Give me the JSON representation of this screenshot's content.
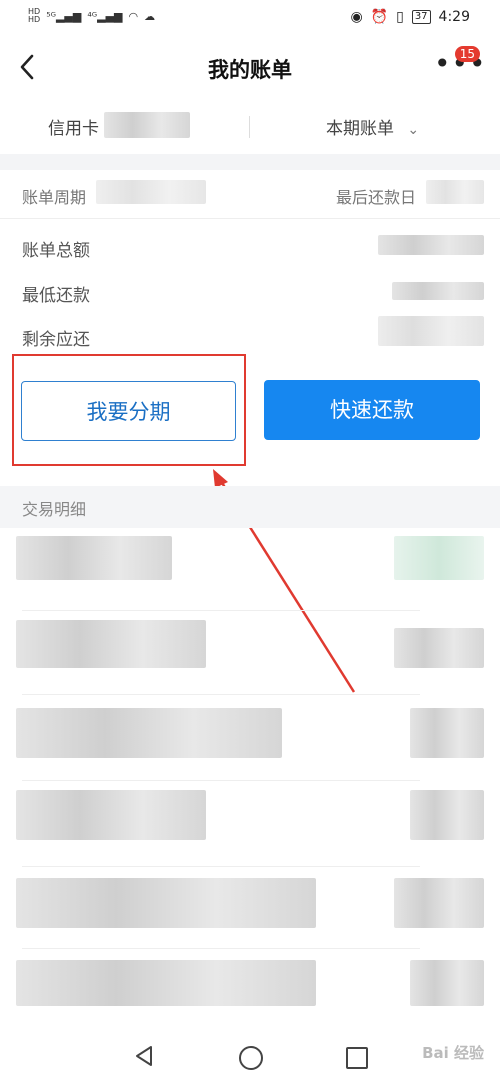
{
  "status_bar": {
    "signal_left": "HD 5G 4G",
    "time": "4:29",
    "battery": "37"
  },
  "header": {
    "title": "我的账单",
    "more_badge": "15"
  },
  "selector": {
    "card_label": "信用卡",
    "period_label": "本期账单"
  },
  "bill_info": {
    "period_label": "账单周期",
    "due_label": "最后还款日"
  },
  "amounts": [
    {
      "label": "账单总额"
    },
    {
      "label": "最低还款"
    },
    {
      "label": "剩余应还"
    }
  ],
  "actions": {
    "installment_label": "我要分期",
    "repay_label": "快速还款"
  },
  "transactions": {
    "title": "交易明细"
  },
  "watermark": "Bai 经验",
  "colors": {
    "primary": "#1687f0",
    "highlight": "#e03a30",
    "badge": "#e43a2f"
  }
}
